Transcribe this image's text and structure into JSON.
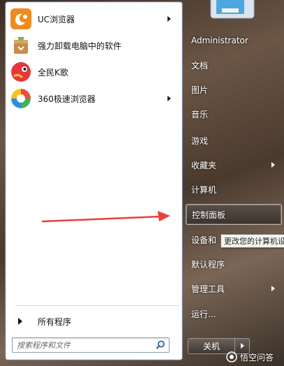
{
  "programs": [
    {
      "label": "UC浏览器",
      "icon": "uc-browser-icon",
      "has_submenu": true
    },
    {
      "label": "强力卸载电脑中的软件",
      "icon": "uninstall-icon",
      "has_submenu": false
    },
    {
      "label": "全民K歌",
      "icon": "karaoke-icon",
      "has_submenu": false
    },
    {
      "label": "360极速浏览器",
      "icon": "360-browser-icon",
      "has_submenu": true
    }
  ],
  "all_programs_label": "所有程序",
  "search": {
    "placeholder": "搜索程序和文件"
  },
  "right_menu": [
    {
      "label": "Administrator",
      "has_submenu": false
    },
    {
      "label": "文档",
      "has_submenu": false
    },
    {
      "label": "图片",
      "has_submenu": false
    },
    {
      "label": "音乐",
      "has_submenu": false
    },
    {
      "label": "游戏",
      "has_submenu": false
    },
    {
      "label": "收藏夹",
      "has_submenu": true
    },
    {
      "label": "计算机",
      "has_submenu": false
    },
    {
      "label": "控制面板",
      "has_submenu": false,
      "highlighted": true
    },
    {
      "label": "设备和",
      "has_submenu": false
    },
    {
      "label": "默认程序",
      "has_submenu": false
    },
    {
      "label": "管理工具",
      "has_submenu": true
    },
    {
      "label": "运行...",
      "has_submenu": false
    }
  ],
  "tooltip": "更改您的计算机设",
  "shutdown_label": "关机",
  "watermark": "悟空问答",
  "colors": {
    "annotation_arrow": "#e8403a",
    "highlight_border": "#bdb3aa"
  }
}
